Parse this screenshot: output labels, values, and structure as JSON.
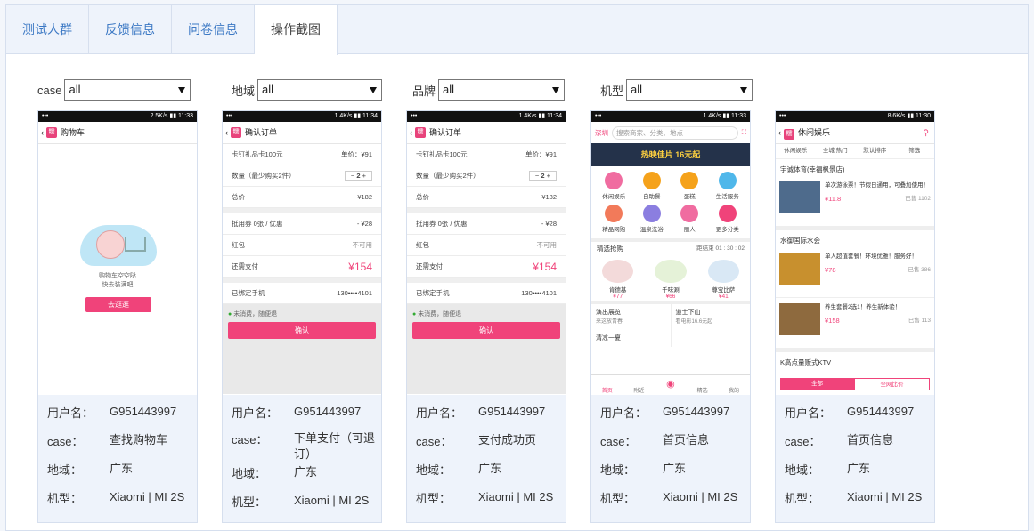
{
  "tabs": [
    {
      "label": "测试人群"
    },
    {
      "label": "反馈信息"
    },
    {
      "label": "问卷信息"
    },
    {
      "label": "操作截图",
      "active": true
    }
  ],
  "filters": [
    {
      "label": "case",
      "value": "all"
    },
    {
      "label": "地域",
      "value": "all"
    },
    {
      "label": "品牌",
      "value": "all"
    },
    {
      "label": "机型",
      "value": "all"
    }
  ],
  "info_labels": {
    "user": "用户名：",
    "case": "case：",
    "region": "地域：",
    "model": "机型："
  },
  "cards": [
    {
      "user": "G951443997",
      "case": "查找购物车",
      "region": "广东",
      "model": "Xiaomi | MI 2S",
      "phone": {
        "status_left": "•••",
        "status_right": "2.5K/s  ▮▮ 11:33",
        "title": "购物车",
        "empty_line1": "购物车空空哒",
        "empty_line2": "快去装满吧",
        "button": "去逛逛"
      }
    },
    {
      "user": "G951443997",
      "case": "下单支付（可退订）",
      "region": "广东",
      "model": "Xiaomi | MI 2S",
      "phone": {
        "status_left": "•••",
        "status_right": "1.4K/s  ▮▮ 11:34",
        "title": "确认订单",
        "item": "卡钉礼品卡100元",
        "price": "单价：¥91",
        "qty_label": "数量（最少购买2件）",
        "qty": "2",
        "total_label": "总价",
        "total": "¥182",
        "coupon_label": "抵用券 0张 / 优惠",
        "coupon": "- ¥28",
        "redpack_label": "红包",
        "redpack": "不可用",
        "pay_label": "还需支付",
        "pay": "¥154",
        "phone_label": "已绑定手机",
        "phone_no": "130••••4101",
        "note": "未消费，随便退",
        "button": "确认"
      }
    },
    {
      "user": "G951443997",
      "case": "支付成功页",
      "region": "广东",
      "model": "Xiaomi | MI 2S",
      "phone": {
        "status_left": "•••",
        "status_right": "1.4K/s  ▮▮ 11:34",
        "title": "确认订单",
        "item": "卡钉礼品卡100元",
        "price": "单价：¥91",
        "qty_label": "数量（最少购买2件）",
        "qty": "2",
        "total_label": "总价",
        "total": "¥182",
        "coupon_label": "抵用券 0张 / 优惠",
        "coupon": "- ¥28",
        "redpack_label": "红包",
        "redpack": "不可用",
        "pay_label": "还需支付",
        "pay": "¥154",
        "phone_label": "已绑定手机",
        "phone_no": "130••••4101",
        "note": "未消费，随便退",
        "button": "确认"
      }
    },
    {
      "user": "G951443997",
      "case": "首页信息",
      "region": "广东",
      "model": "Xiaomi | MI 2S",
      "phone": {
        "status_left": "•••",
        "status_right": "1.4K/s  ▮▮ 11:33",
        "city": "深圳",
        "search": "搜索商家、分类、地点",
        "banner": "热映佳片 16元起",
        "icons": [
          "休闲娱乐",
          "自助餐",
          "蛋糕",
          "生活服务",
          "精品网购",
          "温泉洗浴",
          "丽人",
          "更多分类"
        ],
        "flash": "精选抢购",
        "countdown": "距结束 01 : 30 : 02",
        "deals": [
          {
            "name": "肯德基",
            "price": "¥77"
          },
          {
            "name": "千味涮",
            "price": "¥66"
          },
          {
            "name": "尊宝比萨",
            "price": "¥41"
          }
        ],
        "promo1": "演出展览",
        "promo1_sub": "来这放青春",
        "promo2": "道士下山",
        "promo2_sub": "看电影16.6元起",
        "promo3": "清凉一夏",
        "bottom": [
          "首页",
          "附近",
          "",
          "精选",
          "我的"
        ]
      }
    },
    {
      "user": "G951443997",
      "case": "首页信息",
      "region": "广东",
      "model": "Xiaomi | MI 2S",
      "phone": {
        "status_left": "•••",
        "status_right": "8.6K/s  ▮▮ 11:30",
        "title": "休闲娱乐",
        "filters": [
          "休闲娱乐",
          "全城 热门",
          "默认排序",
          "筛选"
        ],
        "shop1": "宇诚体育(幸福枫景店)",
        "shop1_deal": "单次游泳票！节假日通用，可叠加使用！",
        "shop1_price": "¥11.8",
        "shop1_sold": "已售 1102",
        "shop2": "水御国际水会",
        "shop2_deal1": "单人超值套餐！环境优雅！服务好！",
        "shop2_price1": "¥78",
        "shop2_sold1": "已售 386",
        "shop2_deal2": "养生套餐2选1！养生新体验！",
        "shop2_price2": "¥158",
        "shop2_sold2": "已售 113",
        "shop3": "K高点量贩式KTV",
        "btn_all": "全部",
        "btn_compare": "全网比价"
      }
    }
  ]
}
